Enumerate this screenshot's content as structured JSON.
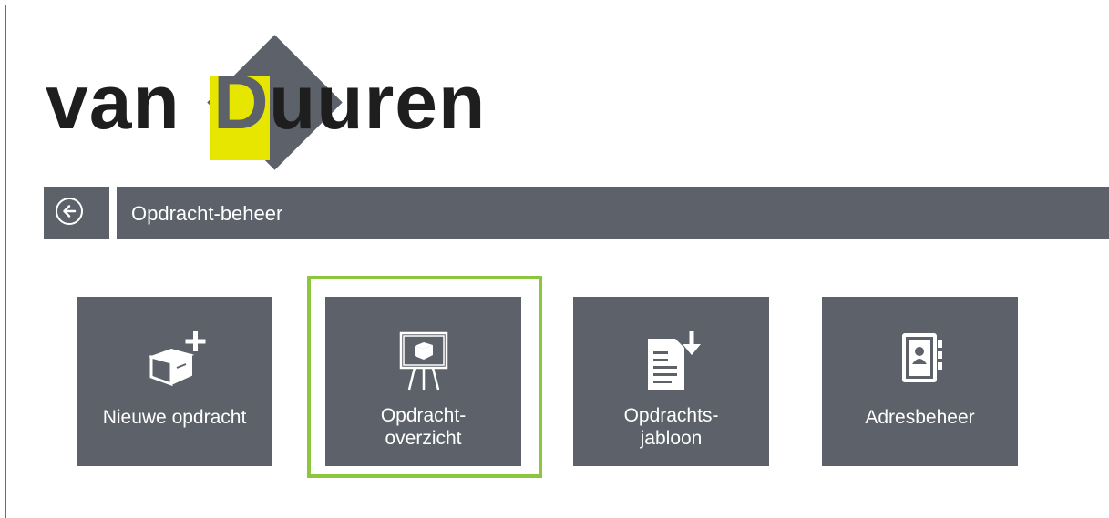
{
  "logo": {
    "text_van": "van",
    "text_d": "D",
    "text_uuren": "uuren",
    "colors": {
      "diamond": "#5c616a",
      "d_box": "#e6e600",
      "text": "#1e1e1e"
    }
  },
  "header": {
    "back_icon": "arrow-left-circle-icon",
    "title": "Opdracht-beheer"
  },
  "tiles": [
    {
      "label": "Nieuwe opdracht",
      "icon": "new-box-plus-icon",
      "selected": false
    },
    {
      "label": "Opdracht-\noverzicht",
      "icon": "presentation-board-icon",
      "selected": true
    },
    {
      "label": "Opdrachts-\njabloon",
      "icon": "document-download-icon",
      "selected": false
    },
    {
      "label": "Adresbeheer",
      "icon": "address-book-icon",
      "selected": false
    }
  ],
  "colors": {
    "tile": "#5c616a",
    "selection": "#8cc63f",
    "bar": "#5c616a"
  }
}
